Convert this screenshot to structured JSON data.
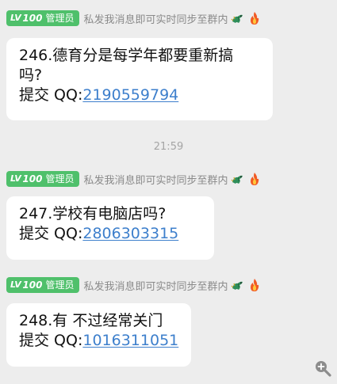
{
  "messages": [
    {
      "badge_lv": "LV",
      "badge_level": "100",
      "badge_role": "管理员",
      "nickname": "私发我消息即可实时同步至群内",
      "line1": "246.德育分是每学年都要重新搞",
      "line2": "吗?",
      "qq_prefix": "提交 QQ:",
      "qq_number": "2190559794"
    },
    {
      "badge_lv": "LV",
      "badge_level": "100",
      "badge_role": "管理员",
      "nickname": "私发我消息即可实时同步至群内",
      "line1": "247.学校有电脑店吗?",
      "qq_prefix": "提交 QQ:",
      "qq_number": "2806303315"
    },
    {
      "badge_lv": "LV",
      "badge_level": "100",
      "badge_role": "管理员",
      "nickname": "私发我消息即可实时同步至群内",
      "line1": "248.有 不过经常关门",
      "qq_prefix": "提交 QQ:",
      "qq_number": "1016311051"
    }
  ],
  "timestamp": "21:59",
  "emoji_icons": [
    "dragon-icon",
    "fire-icon"
  ],
  "colors": {
    "background": "#ededed",
    "badge": "#4fc06b",
    "link": "#3d7fcc",
    "nickname": "#8a8a8a"
  }
}
